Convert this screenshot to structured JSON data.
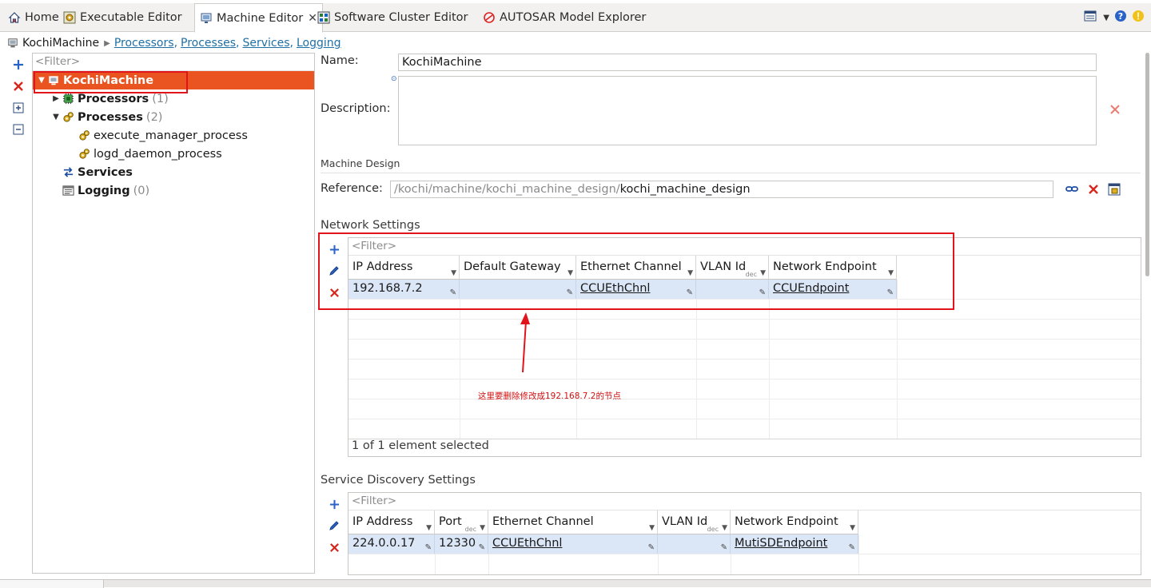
{
  "tabs": [
    {
      "label": "Home",
      "icon": "home-icon"
    },
    {
      "label": "Executable Editor",
      "icon": "executable-icon"
    },
    {
      "label": "Machine Editor",
      "icon": "machine-icon",
      "active": true
    },
    {
      "label": "Software Cluster Editor",
      "icon": "cluster-icon"
    },
    {
      "label": "AUTOSAR Model Explorer",
      "icon": "autosar-icon"
    }
  ],
  "breadcrumb": {
    "root": "KochiMachine",
    "links": [
      "Processors",
      "Processes",
      "Services",
      "Logging"
    ]
  },
  "tree": {
    "filter_placeholder": "<Filter>",
    "root": "KochiMachine",
    "processors": {
      "label": "Processors",
      "count": "(1)"
    },
    "processes": {
      "label": "Processes",
      "count": "(2)",
      "children": [
        "execute_manager_process",
        "logd_daemon_process"
      ]
    },
    "services": {
      "label": "Services"
    },
    "logging": {
      "label": "Logging",
      "count": "(0)"
    }
  },
  "form": {
    "name_label": "Name:",
    "name_value": "KochiMachine",
    "description_label": "Description:",
    "description_value": "",
    "machine_design_section": "Machine Design",
    "reference_label": "Reference:",
    "reference_path": "/kochi/machine/kochi_machine_design/",
    "reference_name": "kochi_machine_design"
  },
  "network": {
    "section": "Network Settings",
    "filter_placeholder": "<Filter>",
    "columns": [
      "IP Address",
      "Default Gateway",
      "Ethernet Channel",
      "VLAN Id",
      "Network Endpoint"
    ],
    "vlan_format": "dec",
    "rows": [
      {
        "ip": "192.168.7.2",
        "gateway": "",
        "channel": "CCUEthChnl",
        "vlan": "",
        "endpoint": "CCUEndpoint"
      }
    ],
    "status": "1 of 1 element selected",
    "annotation": "这里要删除修改成192.168.7.2的节点"
  },
  "sd": {
    "section": "Service Discovery Settings",
    "filter_placeholder": "<Filter>",
    "columns": [
      "IP Address",
      "Port",
      "Ethernet Channel",
      "VLAN Id",
      "Network Endpoint"
    ],
    "port_format": "dec",
    "vlan_format": "dec",
    "rows": [
      {
        "ip": "224.0.0.17",
        "port": "12330",
        "channel": "CCUEthChnl",
        "vlan": "",
        "endpoint": "MutiSDEndpoint"
      }
    ]
  },
  "colors": {
    "selection": "#e95420",
    "highlight_box": "#e0141a",
    "row_selected": "#dbe6f7",
    "link": "#1f6fa6"
  }
}
